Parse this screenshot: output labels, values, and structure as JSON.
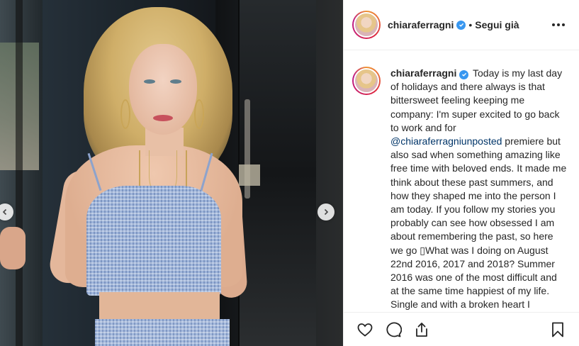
{
  "post": {
    "username": "chiaraferragni",
    "separator": "•",
    "follow_label": "Segui già",
    "caption": {
      "part1": "Today is my last day of holidays and there always is that bittersweet feeling keeping me company: I'm super excited to go back to work and for ",
      "mention": "@chiaraferragniunposted",
      "part2": " premiere but also sad when something amazing like free time with beloved ends. It made me think about these past summers, and how they shaped me into the person I am today. If you follow my stories you probably can see how obsessed I am about remembering the past, so here we go ▯What was I doing on August 22nd 2016, 2017 and 2018? Summer 2016 was one of the most difficult and at the same time happiest of my life. Single and with a broken heart I"
    }
  },
  "icons": {
    "verified": "verified-badge-icon",
    "more": "more-options-icon",
    "like": "heart-icon",
    "comment": "comment-bubble-icon",
    "share": "share-icon",
    "save": "bookmark-icon",
    "prev": "chevron-left-icon",
    "next": "chevron-right-icon"
  },
  "colors": {
    "verified": "#3897f0",
    "text": "#262626",
    "mention": "#003569",
    "border": "#efefef"
  }
}
